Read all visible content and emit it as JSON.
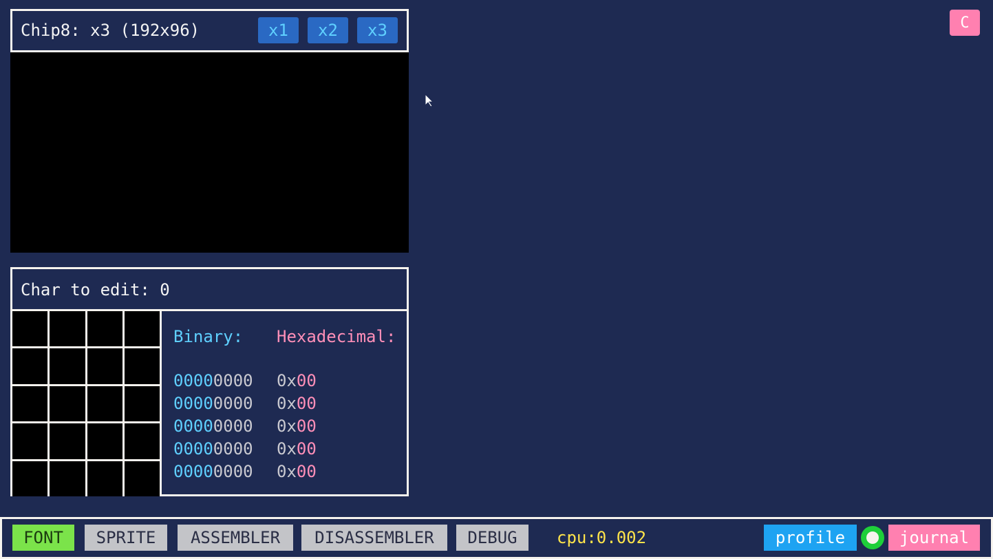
{
  "screen": {
    "title": "Chip8: x3 (192x96)",
    "zoom_buttons": [
      "x1",
      "x2",
      "x3"
    ]
  },
  "corner_button": {
    "label": "C"
  },
  "editor": {
    "char_label": "Char to edit: 0",
    "binary_label": "Binary:",
    "hex_label": "Hexadecimal:",
    "rows": [
      {
        "bin_a": "0000",
        "bin_b": "0000",
        "hex_a": "0x",
        "hex_b": "00"
      },
      {
        "bin_a": "0000",
        "bin_b": "0000",
        "hex_a": "0x",
        "hex_b": "00"
      },
      {
        "bin_a": "0000",
        "bin_b": "0000",
        "hex_a": "0x",
        "hex_b": "00"
      },
      {
        "bin_a": "0000",
        "bin_b": "0000",
        "hex_a": "0x",
        "hex_b": "00"
      },
      {
        "bin_a": "0000",
        "bin_b": "0000",
        "hex_a": "0x",
        "hex_b": "00"
      }
    ]
  },
  "bottom_bar": {
    "tabs": [
      "FONT",
      "SPRITE",
      "ASSEMBLER",
      "DISASSEMBLER",
      "DEBUG"
    ],
    "active_tab": "FONT",
    "cpu_label": "cpu:",
    "cpu_value": "0.002",
    "profile_label": "profile",
    "journal_label": "journal"
  },
  "colors": {
    "background": "#1e2a52",
    "binary": "#5fd0ff",
    "hex": "#ff8fb8",
    "active_tab": "#7be34a",
    "cpu": "#ffe44a",
    "profile": "#1ea3f2",
    "journal": "#ff80b0",
    "status_dot": "#1ecf3a"
  }
}
